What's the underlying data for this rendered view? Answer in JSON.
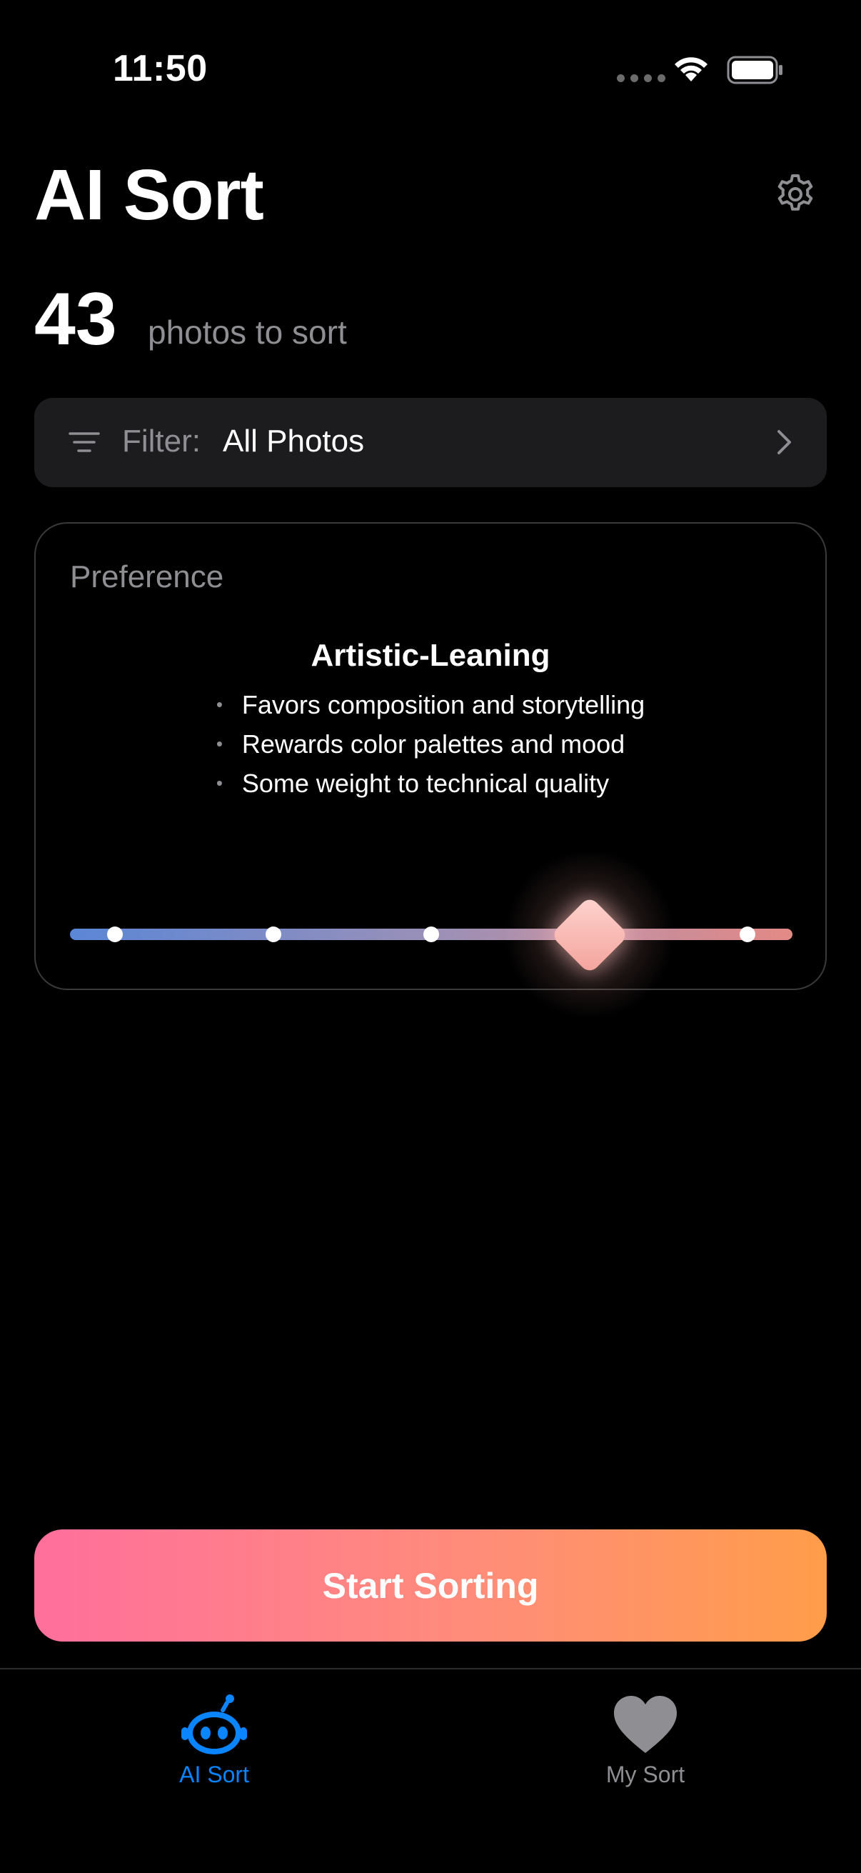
{
  "status_bar": {
    "time": "11:50",
    "icons": [
      "cellular-icon",
      "wifi-icon",
      "battery-icon"
    ]
  },
  "header": {
    "title": "AI Sort",
    "settings_icon": "gear-icon"
  },
  "summary": {
    "count": "43",
    "label": "photos to sort"
  },
  "filter": {
    "label": "Filter:",
    "value": "All Photos",
    "icon": "filter-lines-icon",
    "chevron": "chevron-right-icon"
  },
  "preference": {
    "label": "Preference",
    "title": "Artistic-Leaning",
    "bullets": [
      "Favors composition and storytelling",
      "Rewards color palettes and mood",
      "Some weight to technical quality"
    ],
    "slider": {
      "stops": 5,
      "selected_index": 3,
      "colors": [
        "#5b86d6",
        "#9a90b8",
        "#e48a86"
      ]
    }
  },
  "actions": {
    "start_label": "Start Sorting",
    "gradient": [
      "#ff6f9c",
      "#ff9d4a"
    ]
  },
  "tab_bar": {
    "tabs": [
      {
        "label": "AI Sort",
        "icon": "robot-icon",
        "active": true,
        "color": "#0a84ff"
      },
      {
        "label": "My Sort",
        "icon": "heart-icon",
        "active": false,
        "color": "#8e8e93"
      }
    ]
  }
}
